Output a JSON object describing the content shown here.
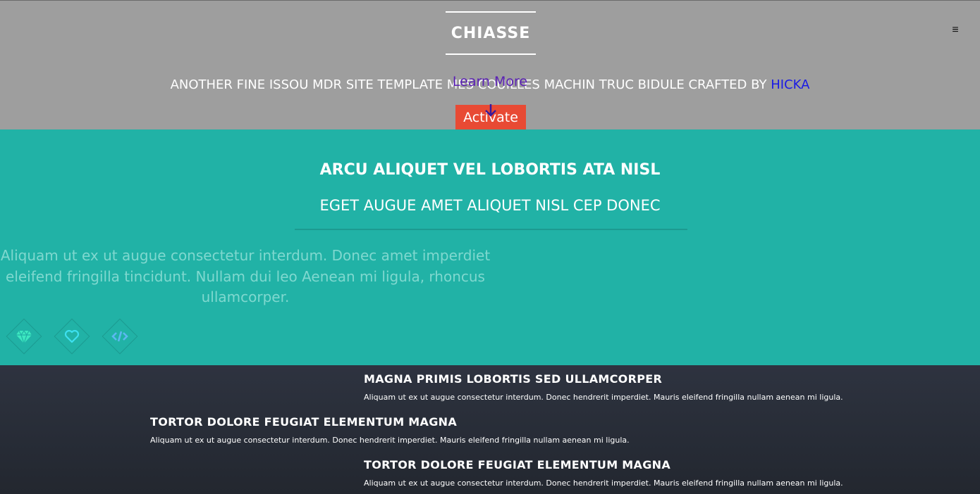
{
  "banner": {
    "logo_title": "CHIASSE",
    "menu_icon": "≡",
    "tagline_text": "ANOTHER FINE ISSOU MDR SITE TEMPLATE MES COUILLES MACHIN TRUC BIDULE CRAFTED BY ",
    "tagline_link": "HICKA",
    "activate_label": "Activate",
    "learn_more_label": "Learn More",
    "colors": {
      "background": "#9e9e9e",
      "activate": "#e84a34",
      "link": "#1a1ae6",
      "learn_more": "#5a1fb5"
    }
  },
  "intro": {
    "heading": "ARCU ALIQUET VEL LOBORTIS ATA NISL",
    "subheading": "EGET AUGUE AMET ALIQUET NISL CEP DONEC",
    "paragraph": "Aliquam ut ex ut augue consectetur interdum. Donec amet imperdiet eleifend fringilla tincidunt. Nullam dui leo Aenean mi ligula, rhoncus ullamcorper.",
    "icons": [
      "diamond-gem-icon",
      "heart-icon",
      "code-icon"
    ],
    "colors": {
      "background": "#21b2a6"
    }
  },
  "features": [
    {
      "title": "MAGNA PRIMIS LOBORTIS SED ULLAMCORPER",
      "text": "Aliquam ut ex ut augue consectetur interdum. Donec hendrerit imperdiet. Mauris eleifend fringilla nullam aenean mi ligula."
    },
    {
      "title": "TORTOR DOLORE FEUGIAT ELEMENTUM MAGNA",
      "text": "Aliquam ut ex ut augue consectetur interdum. Donec hendrerit imperdiet. Mauris eleifend fringilla nullam aenean mi ligula."
    },
    {
      "title": "TORTOR DOLORE FEUGIAT ELEMENTUM MAGNA",
      "text": "Aliquam ut ex ut augue consectetur interdum. Donec hendrerit imperdiet. Mauris eleifend fringilla nullam aenean mi ligula."
    }
  ]
}
